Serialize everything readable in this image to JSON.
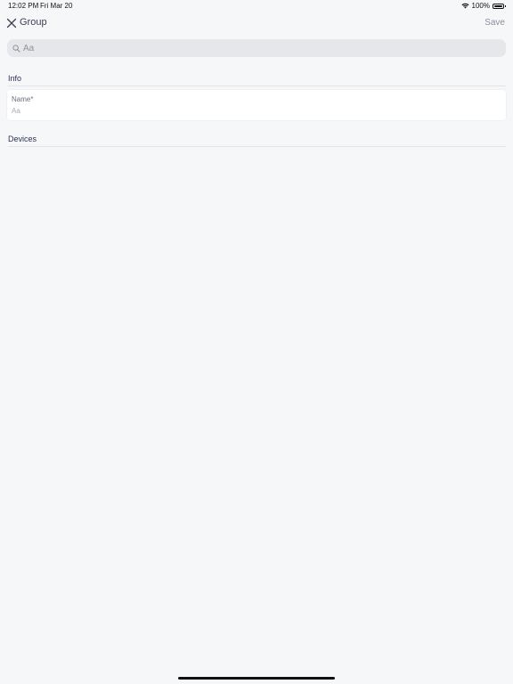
{
  "status_bar": {
    "time": "12:02 PM",
    "date": "Fri Mar 20",
    "battery": "100%"
  },
  "nav": {
    "title": "Group",
    "save_label": "Save"
  },
  "search": {
    "placeholder": "Aa"
  },
  "sections": {
    "info": "Info",
    "devices": "Devices"
  },
  "name_field": {
    "label": "Name*",
    "placeholder": "Aa",
    "value": ""
  }
}
